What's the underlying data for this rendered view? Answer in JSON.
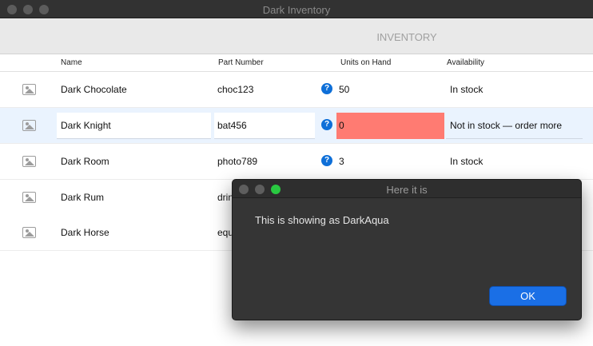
{
  "window": {
    "title": "Dark Inventory"
  },
  "toolbar": {
    "section_title": "INVENTORY"
  },
  "columns": {
    "name": "Name",
    "part_number": "Part Number",
    "units": "Units on Hand",
    "availability": "Availability"
  },
  "rows": [
    {
      "name": "Dark Chocolate",
      "part": "choc123",
      "units": "50",
      "availability": "In stock"
    },
    {
      "name": "Dark Knight",
      "part": "bat456",
      "units": "0",
      "availability": "Not in stock — order more"
    },
    {
      "name": "Dark Room",
      "part": "photo789",
      "units": "3",
      "availability": "In stock"
    },
    {
      "name": "Dark Rum",
      "part": "drin"
    },
    {
      "name": "Dark Horse",
      "part": "equ"
    }
  ],
  "help_icon_glyph": "?",
  "dialog": {
    "title": "Here it is",
    "message": "This is showing as DarkAqua",
    "ok_label": "OK"
  },
  "colors": {
    "selected_row": "#eaf3fe",
    "out_of_stock": "#ff7b72",
    "accent": "#1a6fe6",
    "dialog_bg": "#353535"
  }
}
